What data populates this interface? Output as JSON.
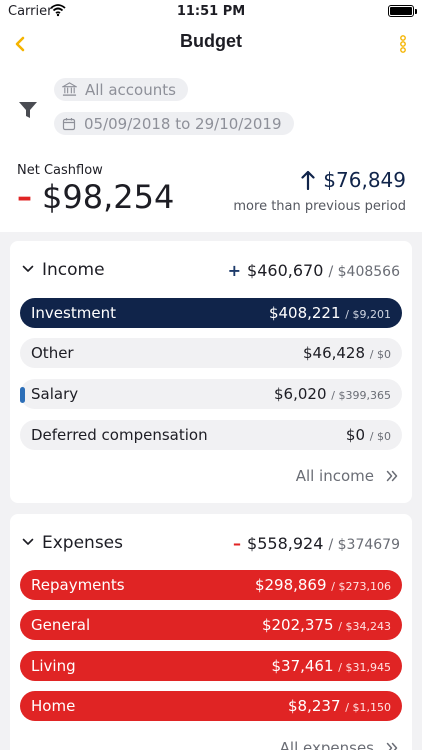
{
  "status_bar": {
    "carrier": "Carrier",
    "time": "11:51 PM"
  },
  "nav": {
    "title": "Budget"
  },
  "filters": {
    "accounts": "All accounts",
    "date_range": "05/09/2018 to 29/10/2019"
  },
  "summary": {
    "net_label": "Net Cashflow",
    "net_sign": "–",
    "net_value": "$98,254",
    "prev_value": "$76,849",
    "prev_caption": "more than previous period"
  },
  "income": {
    "title": "Income",
    "sign": "+",
    "total": "$460,670",
    "budget": "/ $408566",
    "items": [
      {
        "label": "Investment",
        "amount": "$408,221",
        "budget": "/ $9,201"
      },
      {
        "label": "Other",
        "amount": "$46,428",
        "budget": "/ $0"
      },
      {
        "label": "Salary",
        "amount": "$6,020",
        "budget": "/ $399,365"
      },
      {
        "label": "Deferred compensation",
        "amount": "$0",
        "budget": "/ $0"
      }
    ],
    "all_label": "All income"
  },
  "expenses": {
    "title": "Expenses",
    "sign": "–",
    "total": "$558,924",
    "budget": "/ $374679",
    "items": [
      {
        "label": "Repayments",
        "amount": "$298,869",
        "budget": "/ $273,106"
      },
      {
        "label": "General",
        "amount": "$202,375",
        "budget": "/ $34,243"
      },
      {
        "label": "Living",
        "amount": "$37,461",
        "budget": "/ $31,945"
      },
      {
        "label": "Home",
        "amount": "$8,237",
        "budget": "/ $1,150"
      }
    ],
    "all_label": "All expenses"
  },
  "colors": {
    "accent": "#f5b400",
    "navy": "#10244a",
    "red": "#e02424"
  }
}
